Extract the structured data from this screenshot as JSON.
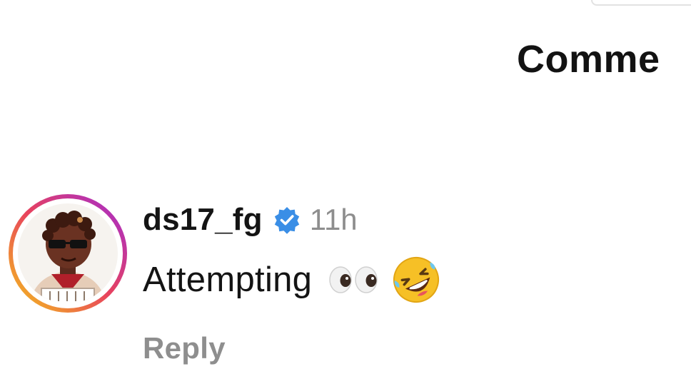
{
  "header": {
    "title": "Comme"
  },
  "comment": {
    "username": "ds17_fg",
    "verified": true,
    "timestamp": "11h",
    "text": "Attempting",
    "emojis": [
      "eyes-emoji",
      "rolling-on-floor-laughing-emoji"
    ],
    "avatar": {
      "icon": "user-avatar",
      "story_ring_colors": [
        "#f4c21b",
        "#e8425d",
        "#a32cd1"
      ]
    },
    "reply_label": "Reply"
  },
  "colors": {
    "verified_badge": "#3a8ee6",
    "secondary_text": "#8e8e8e",
    "primary_text": "#141414"
  }
}
